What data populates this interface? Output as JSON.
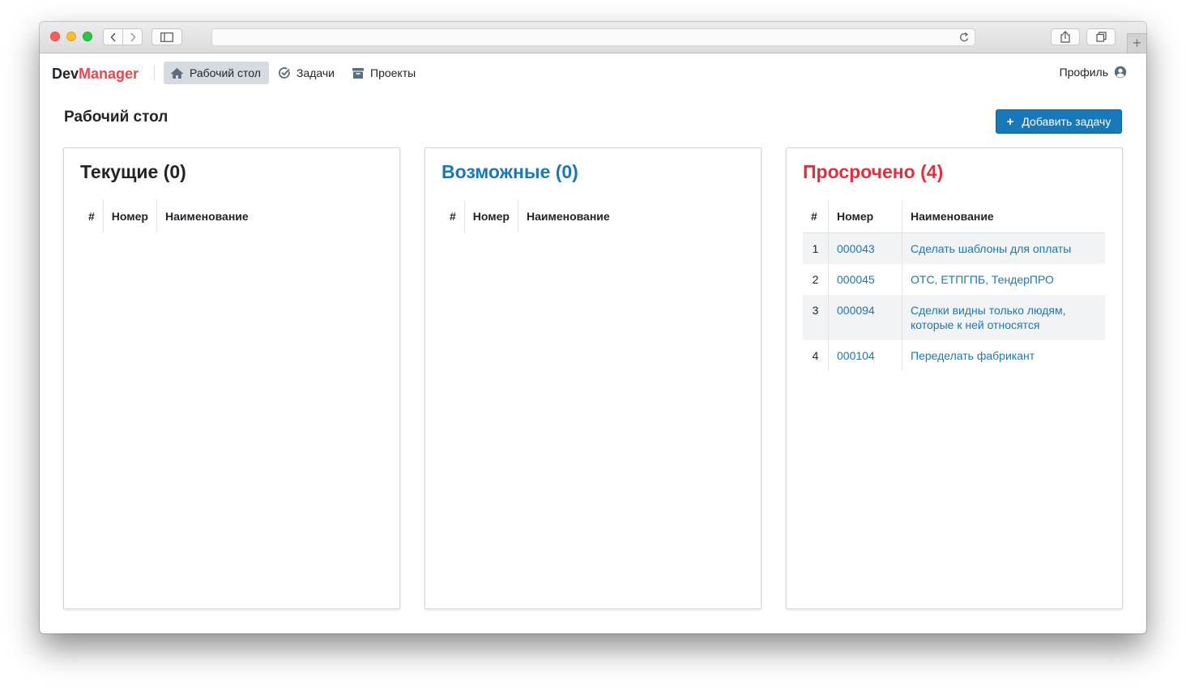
{
  "browser": {
    "url": ""
  },
  "brand": {
    "part1": "Dev",
    "part2": "Manager"
  },
  "nav": {
    "desktop_label": "Рабочий стол",
    "tasks_label": "Задачи",
    "projects_label": "Проекты",
    "profile_label": "Профиль"
  },
  "page": {
    "title": "Рабочий стол",
    "add_task_label": "Добавить задачу"
  },
  "columns": {
    "num": "#",
    "code": "Номер",
    "name": "Наименование"
  },
  "panels": {
    "current": {
      "title": "Текущие (0)"
    },
    "possible": {
      "title": "Возможные (0)"
    },
    "overdue": {
      "title": "Просрочено (4)",
      "rows": [
        {
          "num": "1",
          "code": "000043",
          "name": "Сделать шаблоны для оплаты"
        },
        {
          "num": "2",
          "code": "000045",
          "name": "ОТС, ЕТПГПБ, ТендерПРО"
        },
        {
          "num": "3",
          "code": "000094",
          "name": "Сделки видны только людям, которые к ней относятся"
        },
        {
          "num": "4",
          "code": "000104",
          "name": "Переделать фабрикант"
        }
      ]
    }
  },
  "colors": {
    "brand_accent": "#e8474d",
    "link": "#1779ba",
    "overdue": "#e32e3d",
    "active_nav_bg": "#d5dbe0"
  },
  "icons": {
    "desktop": "home-icon",
    "tasks": "check-circle-icon",
    "projects": "archive-icon",
    "profile": "user-circle-icon"
  }
}
